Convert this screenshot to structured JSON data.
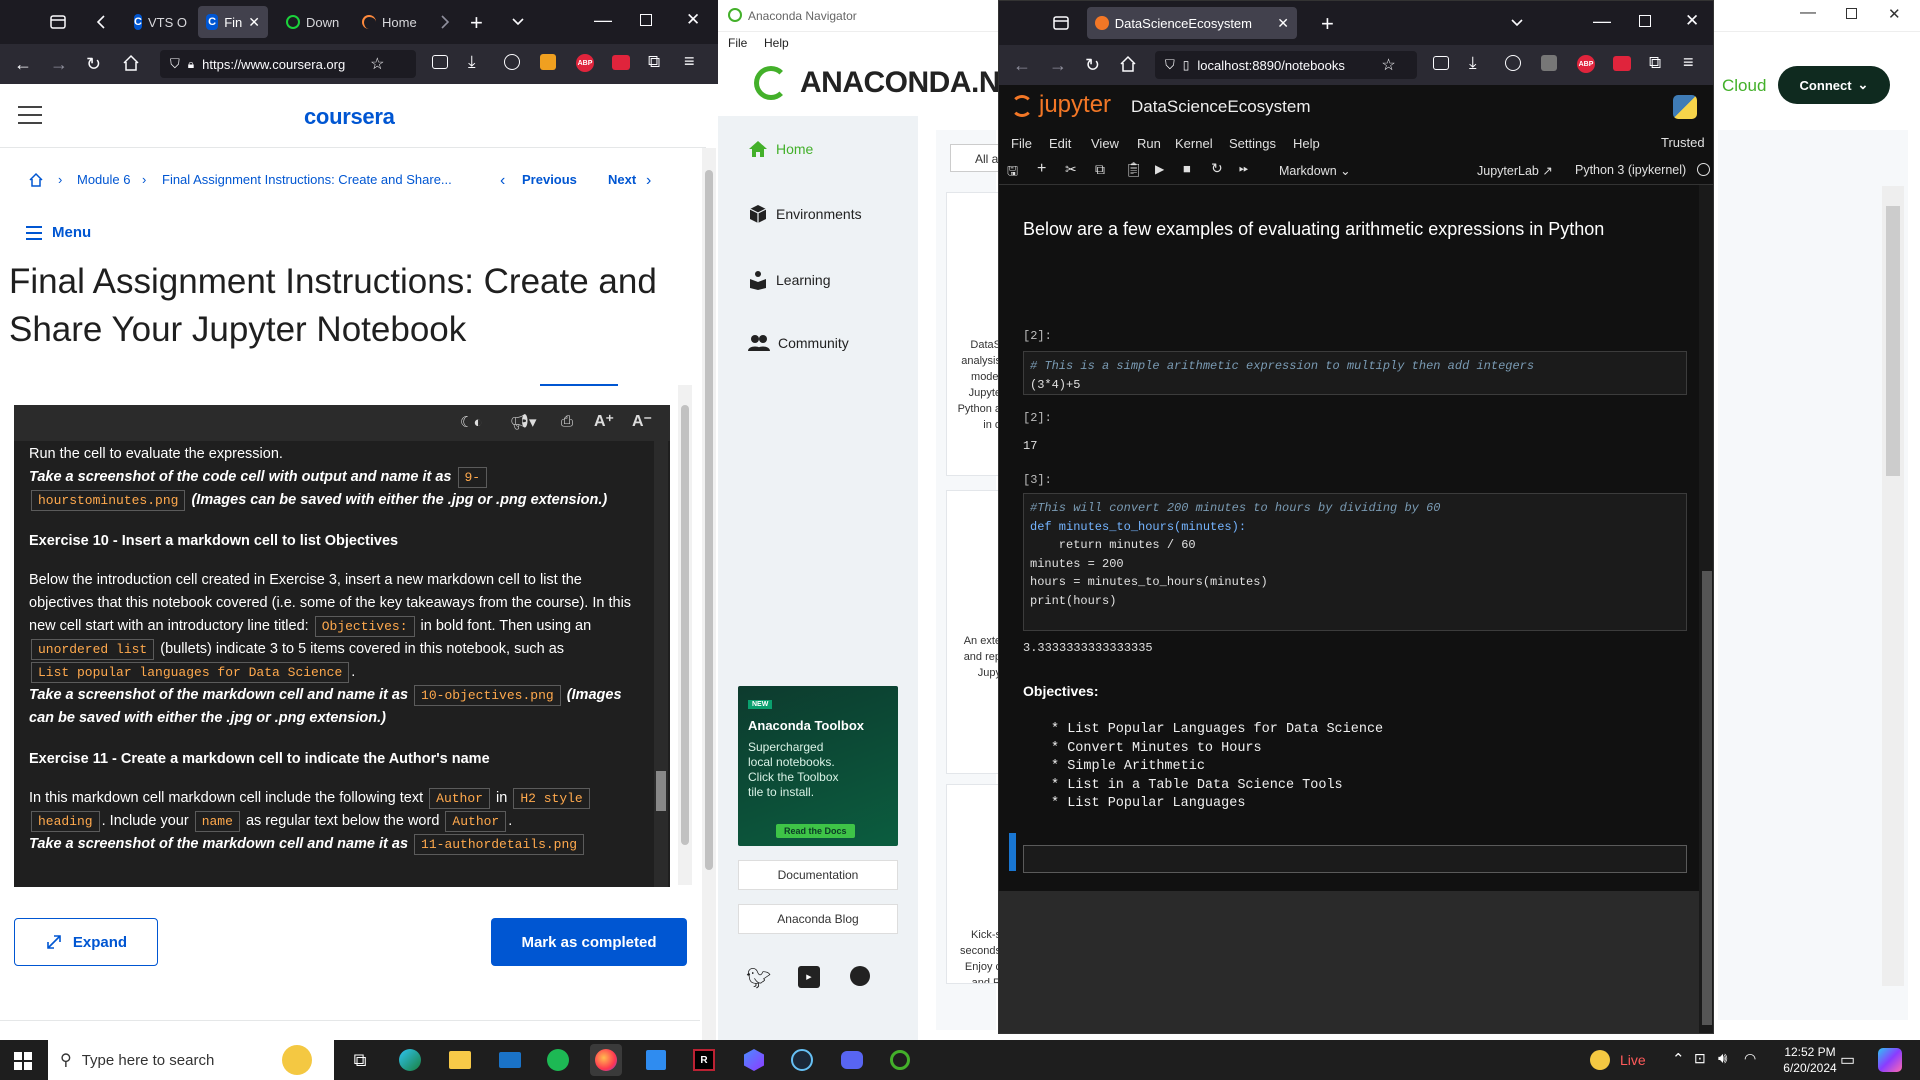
{
  "left_browser": {
    "tabs": [
      {
        "label": "VTS O",
        "icon": "coursera-icon"
      },
      {
        "label": "Fin",
        "icon": "coursera-icon",
        "active": true
      },
      {
        "label": "Down",
        "icon": "download-icon"
      },
      {
        "label": "Home",
        "icon": "swirl-icon"
      }
    ],
    "url": "https://www.coursera.org"
  },
  "coursera": {
    "logo": "coursera",
    "breadcrumb": {
      "module": "Module 6",
      "current": "Final Assignment Instructions: Create and Share...",
      "previous": "Previous",
      "next": "Next"
    },
    "menu_label": "Menu",
    "title": "Final Assignment Instructions: Create and Share Your Jupyter Notebook",
    "panel": {
      "line1": "Run the cell to evaluate the expression.",
      "ss9_a": "Take a screenshot of the code cell with output and name it as",
      "ss9_code_a": "9-",
      "ss9_code_b": "hourstominutes.png",
      "ss9_b": "(Images can be saved with either the .jpg or .png extension.)",
      "ex10_title": "Exercise 10 - Insert a markdown cell to list Objectives",
      "ex10_p1": "Below the introduction cell created in Exercise 3, insert a new markdown cell to list the objectives that this notebook covered (i.e. some of the key takeaways from the course). In this new cell start with an introductory line titled:",
      "ex10_code1": "Objectives:",
      "ex10_p2": "in bold font. Then using an",
      "ex10_code2": "unordered list",
      "ex10_p3": "(bullets) indicate 3 to 5 items covered in this notebook, such as",
      "ex10_code3": "List popular languages for Data Science",
      "ex10_p4": ".",
      "ss10_a": "Take a screenshot of the markdown cell and name it as",
      "ss10_code": "10-objectives.png",
      "ss10_b": "(Images can be saved with either the .jpg or .png extension.)",
      "ex11_title": "Exercise 11 - Create a markdown cell to indicate the Author's name",
      "ex11_p1": "In this markdown cell markdown cell include the following text",
      "ex11_code1": "Author",
      "ex11_p2": "in",
      "ex11_code2a": "H2 style",
      "ex11_code2b": "heading",
      "ex11_p3": ". Include your",
      "ex11_code3": "name",
      "ex11_p4": "as regular text below the word",
      "ex11_code4": "Author",
      "ex11_p5": ".",
      "ss11_a": "Take a screenshot of the markdown cell and name it as",
      "ss11_code": "11-authordetails.png"
    },
    "expand_label": "Expand",
    "mark_complete_label": "Mark as completed"
  },
  "anaconda": {
    "window_title": "Anaconda Navigator",
    "menu": [
      "File",
      "Help"
    ],
    "logo": "ANACONDA.NA",
    "cloud_label": "Cloud",
    "connect_label": "Connect",
    "filter_label": "All a",
    "nav": [
      {
        "label": "Home",
        "icon": "home-icon",
        "active": true
      },
      {
        "label": "Environments",
        "icon": "cube-icon"
      },
      {
        "label": "Learning",
        "icon": "book-icon"
      },
      {
        "label": "Community",
        "icon": "people-icon"
      }
    ],
    "card1_text": [
      "DataS",
      "analysis",
      "model",
      "Jupyte",
      "Python a",
      "in o"
    ],
    "card2_text": [
      "An exte",
      "and rep",
      "Jupy"
    ],
    "card3_text": [
      "Kick-s",
      "seconds",
      "Enjoy c",
      "and R"
    ],
    "promo": {
      "badge": "NEW",
      "title": "Anaconda Toolbox",
      "body": [
        "Supercharged",
        "local notebooks.",
        "Click the Toolbox",
        "tile to install."
      ],
      "button": "Read the Docs"
    },
    "links": [
      "Documentation",
      "Anaconda Blog"
    ],
    "social_icons": [
      "twitter-icon",
      "youtube-icon",
      "github-icon"
    ]
  },
  "jupyter_browser": {
    "tab_title": "DataScienceEcosystem",
    "url": "localhost:8890/notebooks",
    "app_name": "jupyter",
    "notebook_name": "DataScienceEcosystem",
    "trusted": "Trusted",
    "menu": [
      "File",
      "Edit",
      "View",
      "Run",
      "Kernel",
      "Settings",
      "Help"
    ],
    "cell_type": "Markdown",
    "jupyterlab_link": "JupyterLab",
    "kernel": "Python 3 (ipykernel)",
    "notebook": {
      "md_heading": "Below are a few examples of evaluating arithmetic expressions in Python",
      "cell2_prompt": "[2]:",
      "cell2_comment": "# This is a simple arithmetic expression to multiply then add integers",
      "cell2_code": "(3*4)+5",
      "out2_prompt": "[2]:",
      "out2_value": "17",
      "cell3_prompt": "[3]:",
      "cell3_lines": [
        "#This will convert 200 minutes to hours by dividing by 60",
        "def minutes_to_hours(minutes):",
        "    return minutes / 60",
        "minutes = 200",
        "hours = minutes_to_hours(minutes)",
        "print(hours)"
      ],
      "out3_value": "3.3333333333333335",
      "objectives_title": "Objectives:",
      "objectives": [
        "* List Popular Languages for Data Science",
        "* Convert Minutes to Hours",
        "* Simple Arithmetic",
        "* List in a Table Data Science Tools",
        "* List Popular Languages"
      ]
    }
  },
  "taskbar": {
    "search_placeholder": "Type here to search",
    "live_label": "Live",
    "time": "12:52 PM",
    "date": "6/20/2024"
  },
  "colors": {
    "coursera_blue": "#0056d2",
    "anaconda_green": "#43b02a",
    "jupyter_orange": "#f37726",
    "code_orange": "#ffa94d"
  }
}
